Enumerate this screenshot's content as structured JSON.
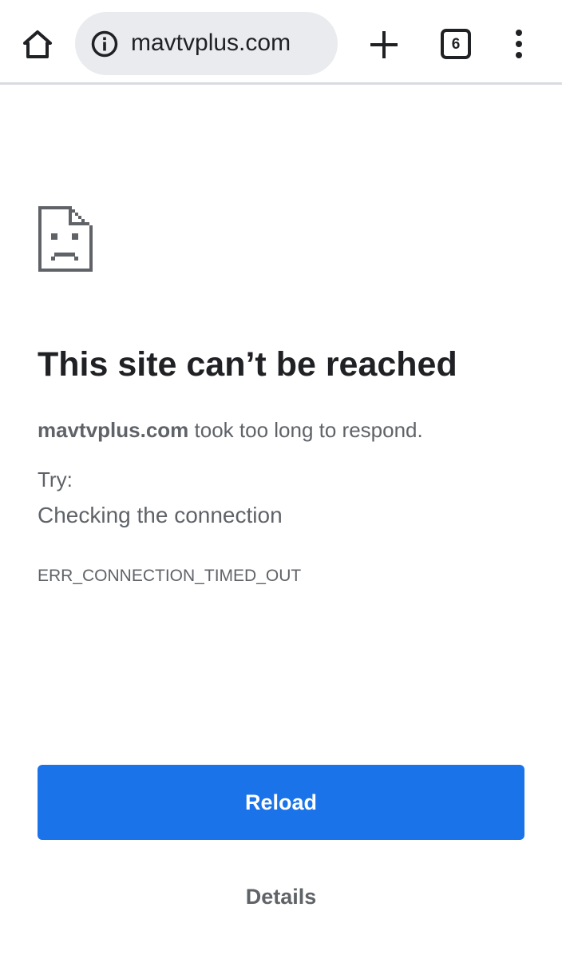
{
  "toolbar": {
    "url": "mavtvplus.com",
    "tab_count": "6",
    "icons": {
      "home": "home-icon",
      "site_info": "info-icon",
      "new_tab": "plus-icon",
      "tab_switcher": "tab-switcher-icon",
      "menu": "more-vertical-icon"
    }
  },
  "error_page": {
    "icon": "sad-page-icon",
    "title": "This site can’t be reached",
    "host": "mavtvplus.com",
    "message": " took too long to respond.",
    "try_label": "Try:",
    "suggestion": "Checking the connection",
    "error_code": "ERR_CONNECTION_TIMED_OUT",
    "reload_label": "Reload",
    "details_label": "Details"
  },
  "colors": {
    "accent": "#1a73e8",
    "omnibox_bg": "#e9ebee",
    "text_primary": "#202124",
    "text_secondary": "#5f6368"
  }
}
